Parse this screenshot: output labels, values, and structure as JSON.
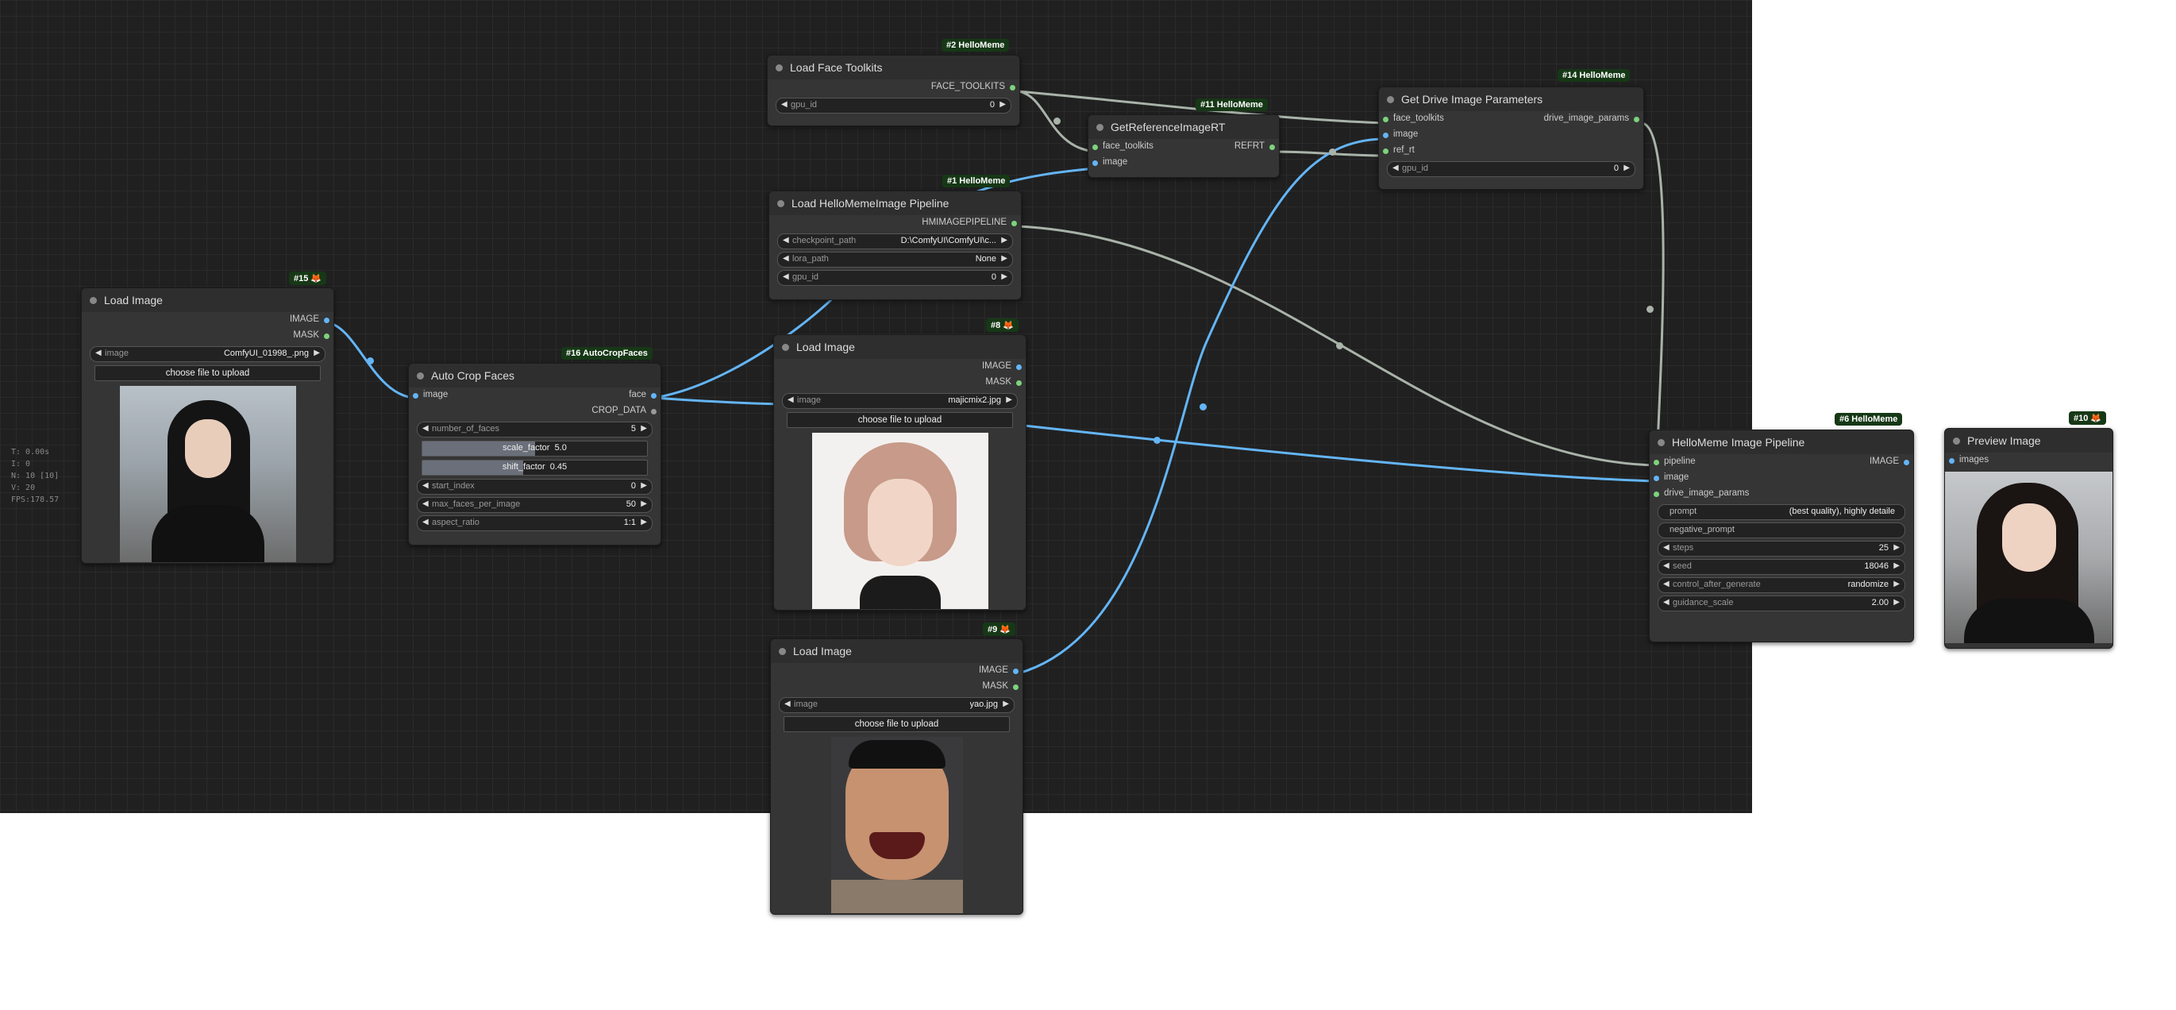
{
  "stats": [
    "T: 0.00s",
    "I: 0",
    "N: 10 [10]",
    "V: 20",
    "FPS:178.57"
  ],
  "nodes": {
    "n15": {
      "badge": "#15",
      "title": "Load Image",
      "outputs": [
        "IMAGE",
        "MASK"
      ],
      "image_name": "image",
      "image_value": "ComfyUI_01998_.png",
      "upload": "choose file to upload"
    },
    "n16": {
      "badge": "#16 AutoCropFaces",
      "title": "Auto Crop Faces",
      "input": "image",
      "outputs": [
        "face",
        "CROP_DATA"
      ],
      "number_of_faces": {
        "name": "number_of_faces",
        "value": "5"
      },
      "scale_factor": {
        "name": "scale_factor",
        "value": "5.0"
      },
      "shift_factor": {
        "name": "shift_factor",
        "value": "0.45"
      },
      "start_index": {
        "name": "start_index",
        "value": "0"
      },
      "max_faces_per_image": {
        "name": "max_faces_per_image",
        "value": "50"
      },
      "aspect_ratio": {
        "name": "aspect_ratio",
        "value": "1:1"
      }
    },
    "n2": {
      "badge": "#2 HelloMeme",
      "title": "Load Face Toolkits",
      "output": "FACE_TOOLKITS",
      "gpu_id": {
        "name": "gpu_id",
        "value": "0"
      }
    },
    "n1": {
      "badge": "#1 HelloMeme",
      "title": "Load HelloMemeImage Pipeline",
      "output": "HMIMAGEPIPELINE",
      "checkpoint_path": {
        "name": "checkpoint_path",
        "value": "D:\\ComfyUI\\ComfyUI\\c..."
      },
      "lora_path": {
        "name": "lora_path",
        "value": "None"
      },
      "gpu_id": {
        "name": "gpu_id",
        "value": "0"
      }
    },
    "n8": {
      "badge": "#8",
      "title": "Load Image",
      "outputs": [
        "IMAGE",
        "MASK"
      ],
      "image_name": "image",
      "image_value": "majicmix2.jpg",
      "upload": "choose file to upload"
    },
    "n9": {
      "badge": "#9",
      "title": "Load Image",
      "outputs": [
        "IMAGE",
        "MASK"
      ],
      "image_name": "image",
      "image_value": "yao.jpg",
      "upload": "choose file to upload"
    },
    "n11": {
      "badge": "#11 HelloMeme",
      "title": "GetReferenceImageRT",
      "inputs": [
        "face_toolkits",
        "image"
      ],
      "output": "REFRT"
    },
    "n14": {
      "badge": "#14 HelloMeme",
      "title": "Get Drive Image Parameters",
      "inputs": [
        "face_toolkits",
        "image",
        "ref_rt"
      ],
      "output": "drive_image_params",
      "gpu_id": {
        "name": "gpu_id",
        "value": "0"
      }
    },
    "n6": {
      "badge": "#6 HelloMeme",
      "title": "HelloMeme Image Pipeline",
      "inputs": [
        "pipeline",
        "image",
        "drive_image_params"
      ],
      "output": "IMAGE",
      "prompt": {
        "name": "prompt",
        "value": "(best quality), highly detaile"
      },
      "negative_prompt": {
        "name": "negative_prompt",
        "value": ""
      },
      "steps": {
        "name": "steps",
        "value": "25"
      },
      "seed": {
        "name": "seed",
        "value": "18046"
      },
      "control_after_generate": {
        "name": "control_after_generate",
        "value": "randomize"
      },
      "guidance_scale": {
        "name": "guidance_scale",
        "value": "2.00"
      }
    },
    "n10": {
      "badge": "#10",
      "title": "Preview Image",
      "input": "images"
    }
  },
  "colors": {
    "image_link": "#64b5f6",
    "other_link": "#a9b3a9",
    "badge_bg": "#163816",
    "canvas": "#202020"
  }
}
